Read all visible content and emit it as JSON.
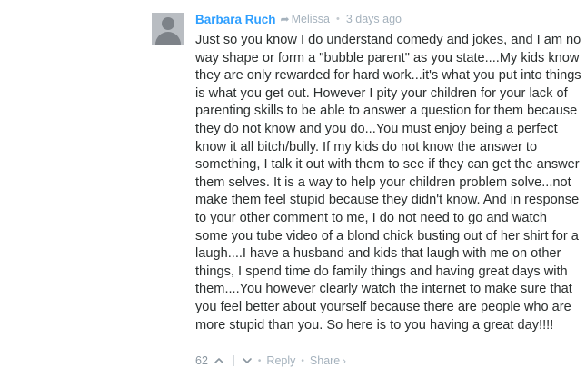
{
  "comment": {
    "author": "Barbara Ruch",
    "reply_arrow_icon": "reply-arrow-icon",
    "reply_to": "Melissa",
    "separator": "•",
    "timestamp": "3 days ago",
    "body": "Just so you know I do understand comedy and jokes, and I am no way shape or form a \"bubble parent\" as you state....My kids know they are only rewarded for hard work...it's what you put into things is what you get out. However I pity your children for your lack of parenting skills to be able to answer a question for them because they do not know and you do...You must enjoy being a perfect know it all bitch/bully. If my kids do not know the answer to something, I talk it out with them to see if they can get the answer them selves. It is a way to help your children problem solve...not make them feel stupid because they didn't know. And in response to your other comment to me, I do not need to go and watch some you tube video of a blond chick busting out of her shirt for a laugh....I have a husband and kids that laugh with me on other things, I spend time do family things and having great days with them....You however clearly watch the internet to make sure that you feel better about yourself because there are people who are more stupid than you. So here is to you having a great day!!!!",
    "footer": {
      "vote_count": "62",
      "upvote_icon": "chevron-up-icon",
      "downvote_icon": "chevron-down-icon",
      "dot": "•",
      "reply_label": "Reply",
      "share_label": "Share",
      "share_chevron": "›"
    }
  },
  "colors": {
    "author": "#2e9fff",
    "meta": "#a5b2bd",
    "body_text": "#2a2e2e",
    "avatar": "#b9bdc2"
  }
}
